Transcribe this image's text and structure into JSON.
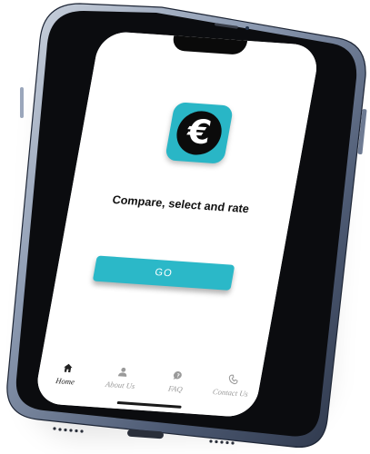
{
  "app": {
    "icon_symbol": "€",
    "icon_name": "euro-coin-icon",
    "accent_color": "#29b6c6"
  },
  "main": {
    "tagline": "Compare, select and rate",
    "go_label": "GO"
  },
  "tabbar": {
    "items": [
      {
        "label": "Home",
        "icon": "home-icon",
        "active": true
      },
      {
        "label": "About Us",
        "icon": "user-icon",
        "active": false
      },
      {
        "label": "FAQ",
        "icon": "question-bubble-icon",
        "active": false
      },
      {
        "label": "Contact Us",
        "icon": "phone-icon",
        "active": false
      }
    ]
  }
}
